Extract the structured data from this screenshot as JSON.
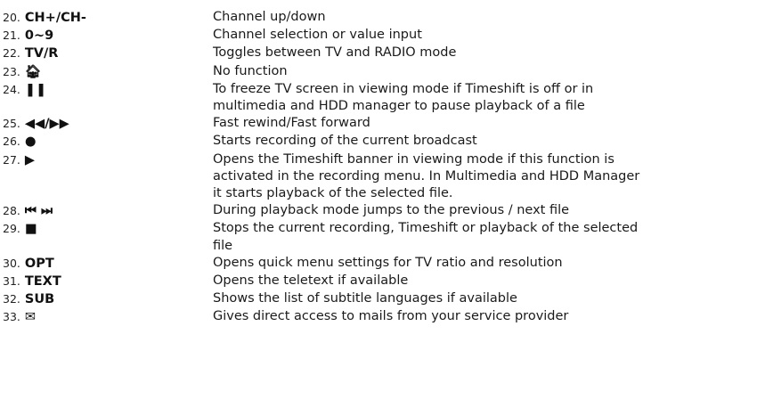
{
  "items": [
    {
      "num": "20.",
      "label": "CH+/CH-",
      "icon": "",
      "desc": [
        "Channel up/down"
      ]
    },
    {
      "num": "21.",
      "label": "0~9",
      "icon": "",
      "desc": [
        "Channel selection or value input"
      ]
    },
    {
      "num": "22.",
      "label": "TV/R",
      "icon": "",
      "desc": [
        "Toggles between TV and RADIO mode"
      ]
    },
    {
      "num": "23.",
      "label": "🏠︎",
      "icon": "home-icon",
      "desc": [
        "No function"
      ]
    },
    {
      "num": "24.",
      "label": "❚❚",
      "icon": "pause-icon",
      "desc": [
        "To freeze TV screen in viewing mode if Timeshift is off or in",
        "multimedia and HDD manager to pause playback of a file"
      ]
    },
    {
      "num": "25.",
      "label": "◀◀/▶▶",
      "icon": "rewind-forward-icon",
      "desc": [
        "Fast rewind/Fast forward"
      ]
    },
    {
      "num": "26.",
      "label": "●",
      "icon": "record-icon",
      "desc": [
        "Starts recording of the current broadcast"
      ]
    },
    {
      "num": "27.",
      "label": "▶",
      "icon": "play-icon",
      "desc": [
        "Opens the Timeshift banner in viewing mode if this function is",
        "activated in the recording menu. In Multimedia and HDD Manager",
        "it starts playback of the selected file."
      ]
    },
    {
      "num": "28.",
      "label": "⏮ ⏭",
      "icon": "skip-previous-next-icon",
      "desc": [
        "During playback mode jumps to the previous / next file"
      ]
    },
    {
      "num": "29.",
      "label": "■",
      "icon": "stop-icon",
      "desc": [
        "Stops the current recording, Timeshift or playback of the selected",
        "file"
      ]
    },
    {
      "num": "30.",
      "label": "OPT",
      "icon": "",
      "desc": [
        "Opens quick menu settings for TV ratio and resolution"
      ]
    },
    {
      "num": "31.",
      "label": "TEXT",
      "icon": "",
      "desc": [
        "Opens the teletext if available"
      ]
    },
    {
      "num": "32.",
      "label": "SUB",
      "icon": "",
      "desc": [
        "Shows the list of subtitle languages if available"
      ]
    },
    {
      "num": "33.",
      "label": "✉",
      "icon": "mail-icon",
      "desc": [
        "Gives direct access to mails from your service provider"
      ]
    }
  ]
}
